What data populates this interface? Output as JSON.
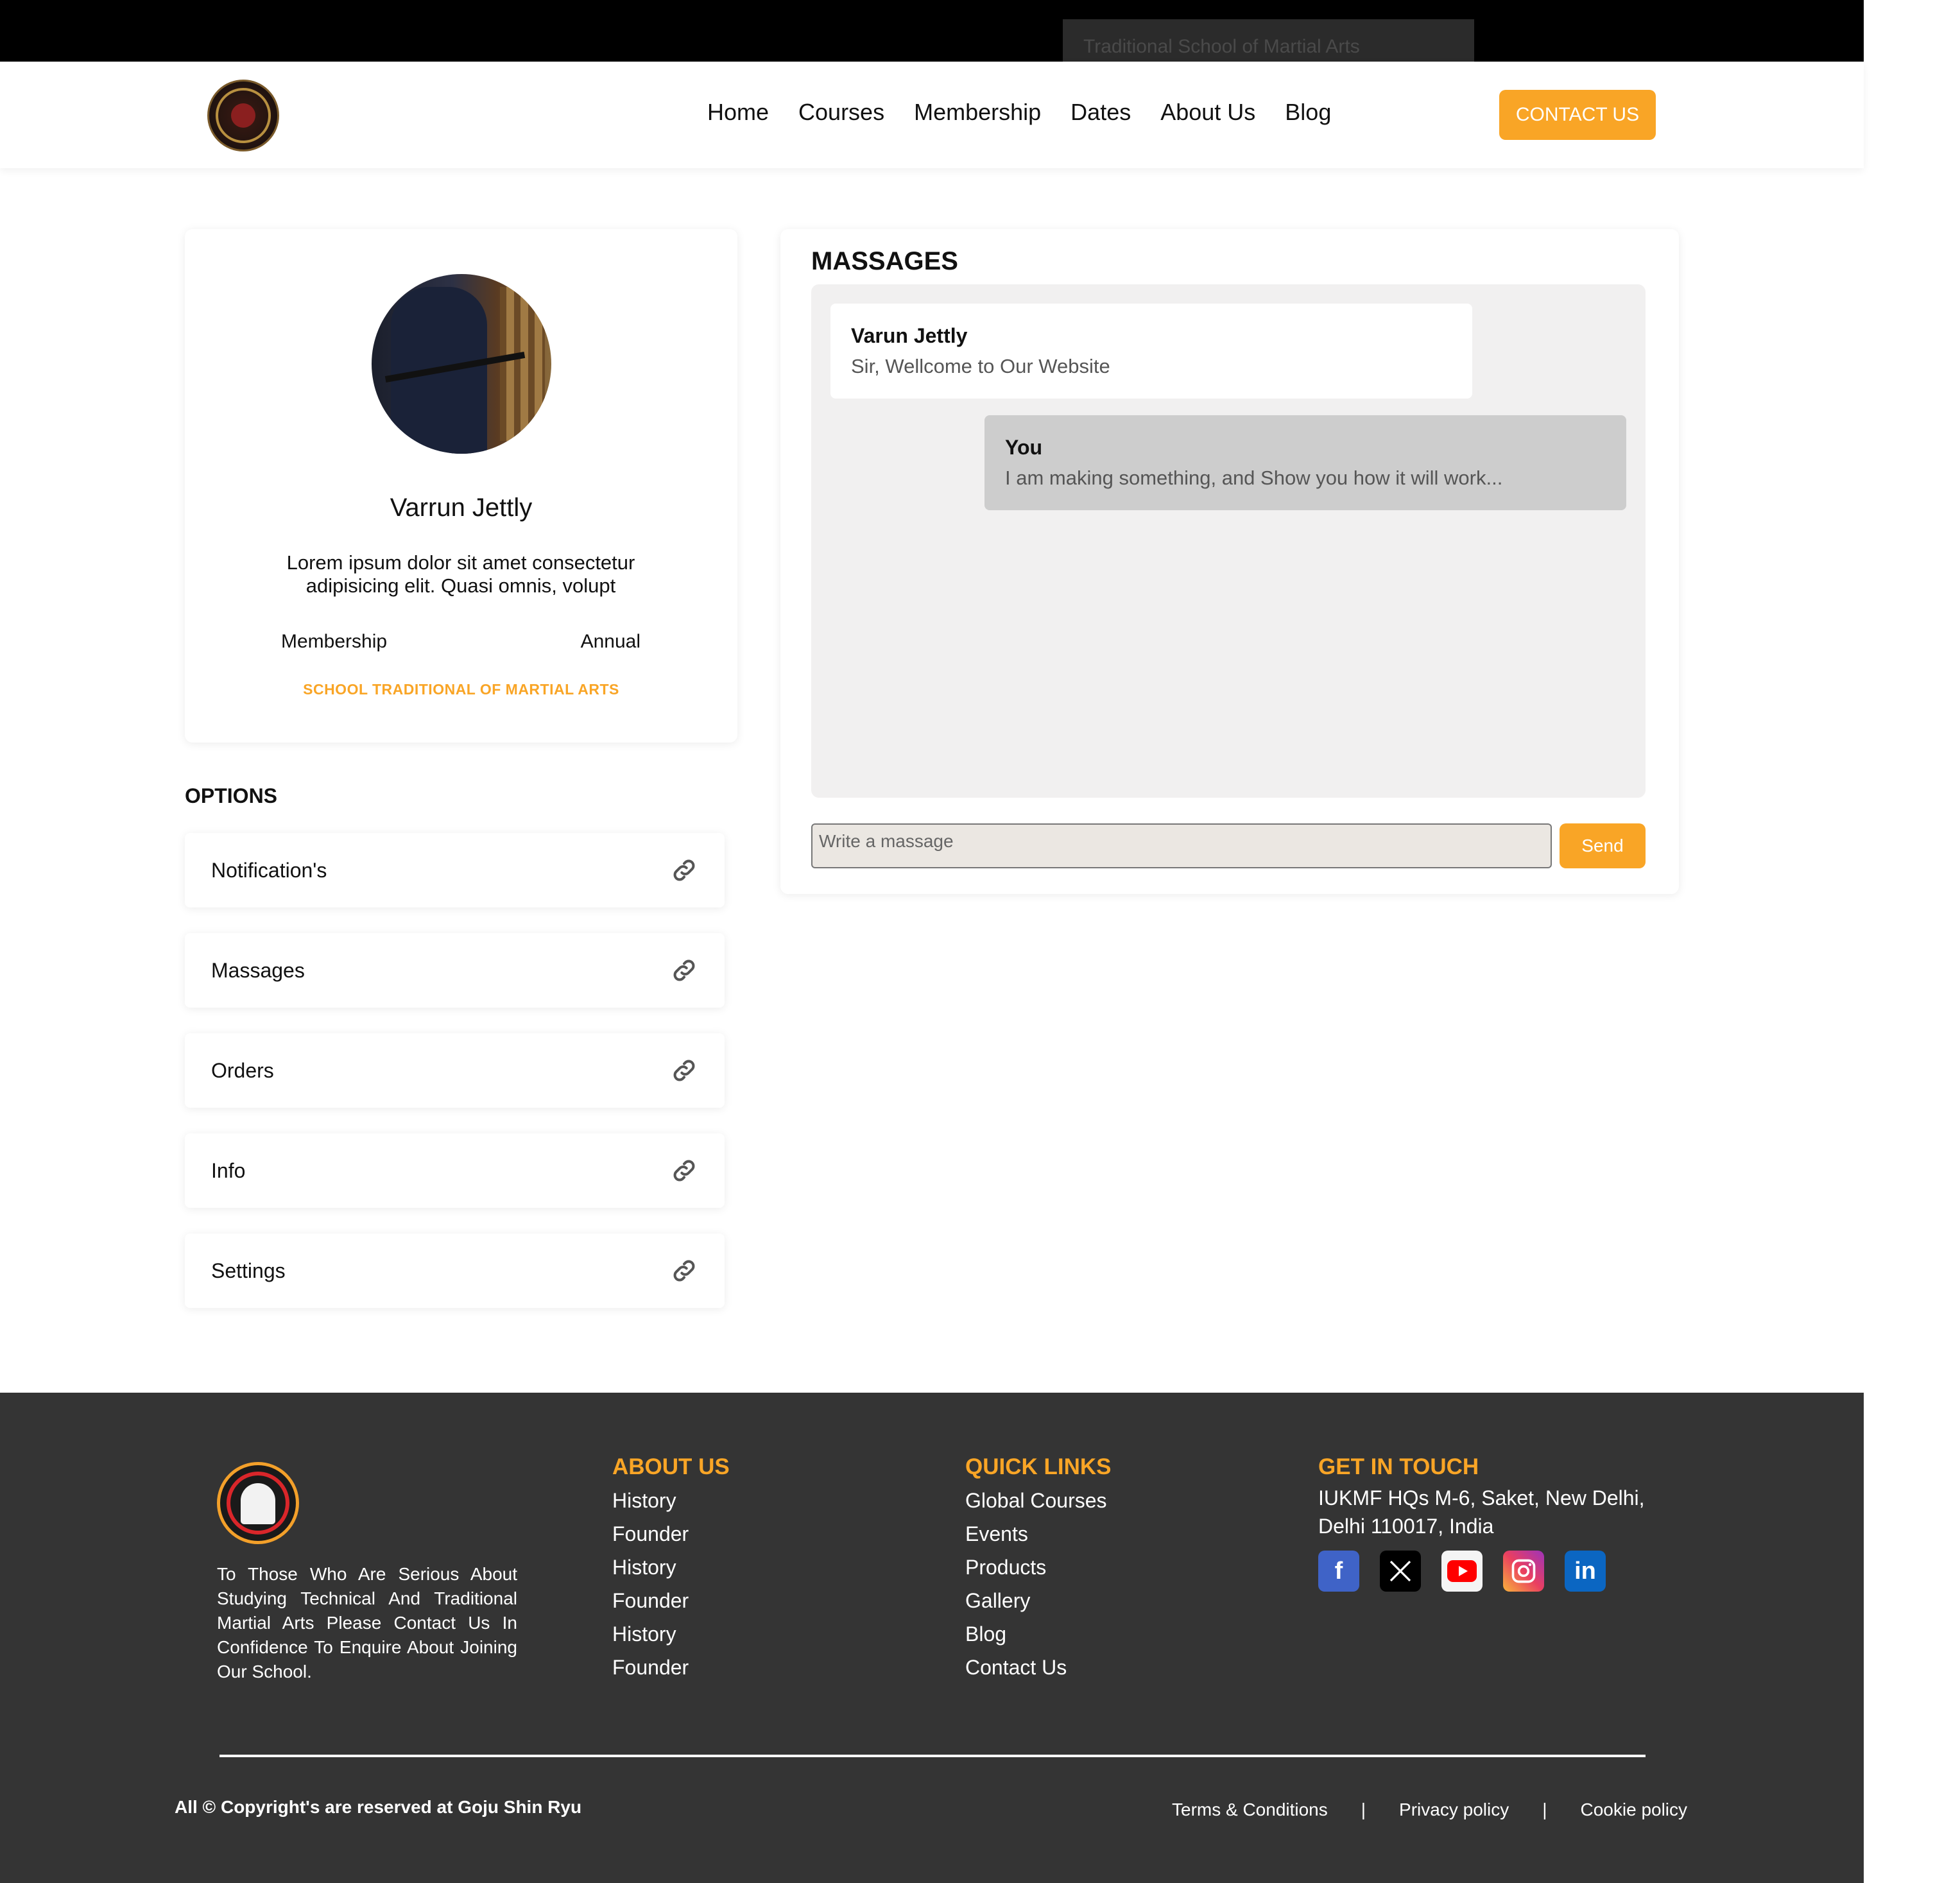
{
  "topbar": {
    "tagline": "Traditional School of Martial Arts"
  },
  "header": {
    "logo_icon": "goju-shin-ryu-logo",
    "nav": [
      "Home",
      "Courses",
      "Membership",
      "Dates",
      "About Us",
      "Blog"
    ],
    "contact_label": "CONTACT US"
  },
  "profile": {
    "name": "Varrun Jettly",
    "description": "Lorem ipsum dolor sit amet consectetur adipisicing elit. Quasi omnis, volupt",
    "membership_label": "Membership",
    "membership_value": "Annual",
    "school": "SCHOOL TRADITIONAL OF MARTIAL ARTS"
  },
  "options": {
    "title": "OPTIONS",
    "items": [
      "Notification's",
      "Massages",
      "Orders",
      "Info",
      "Settings"
    ],
    "item_icon": "link-icon"
  },
  "messages": {
    "title": "MASSAGES",
    "thread": [
      {
        "sender": "Varun Jettly",
        "text": "Sir, Wellcome to Our Website",
        "direction": "incoming"
      },
      {
        "sender": "You",
        "text": "I am making something, and Show you how it will work...",
        "direction": "outgoing"
      }
    ],
    "input_placeholder": "Write a massage",
    "send_label": "Send"
  },
  "footer": {
    "about_text": "To Those Who Are Serious About Studying Technical And Traditional Martial Arts Please Contact Us In Confidence To Enquire About Joining Our School.",
    "about_us": {
      "title": "ABOUT US",
      "links": [
        "History",
        "Founder",
        "History",
        "Founder",
        "History",
        "Founder"
      ]
    },
    "quick_links": {
      "title": "QUICK LINKS",
      "links": [
        "Global Courses",
        "Events",
        "Products",
        "Gallery",
        "Blog",
        "Contact Us"
      ]
    },
    "get_in_touch": {
      "title": "GET IN TOUCH",
      "address": "IUKMF HQs M-6, Saket, New Delhi, Delhi 110017, India",
      "socials": [
        "facebook-icon",
        "x-icon",
        "youtube-icon",
        "instagram-icon",
        "linkedin-icon"
      ]
    },
    "copyright": "All © Copyright's are reserved at Goju Shin Ryu",
    "legal": [
      "Terms & Conditions",
      "Privacy policy",
      "Cookie policy"
    ],
    "legal_separator": "|"
  },
  "colors": {
    "accent": "#f9a526",
    "footer_bg": "#343434",
    "topbar_bg": "#000000"
  }
}
